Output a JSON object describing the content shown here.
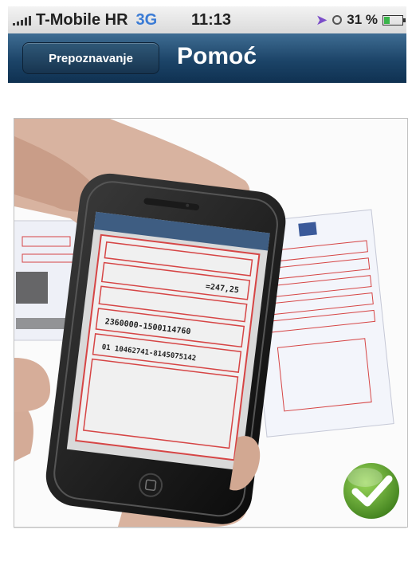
{
  "status_bar": {
    "carrier": "T-Mobile HR",
    "network": "3G",
    "time": "11:13",
    "battery": "31 %",
    "battery_level": 0.31
  },
  "nav_bar": {
    "back_label": "Prepoznavanje",
    "title": "Pomoć"
  },
  "help_image": {
    "slip_amount": "=247,25",
    "slip_account": "2360000-1500114760",
    "slip_reference": "01 10462741-8145075142",
    "success_icon": "checkmark-icon",
    "colors": {
      "accent": "#5aa02c",
      "slip_red": "#d64545",
      "nav": "#1c4468"
    }
  }
}
